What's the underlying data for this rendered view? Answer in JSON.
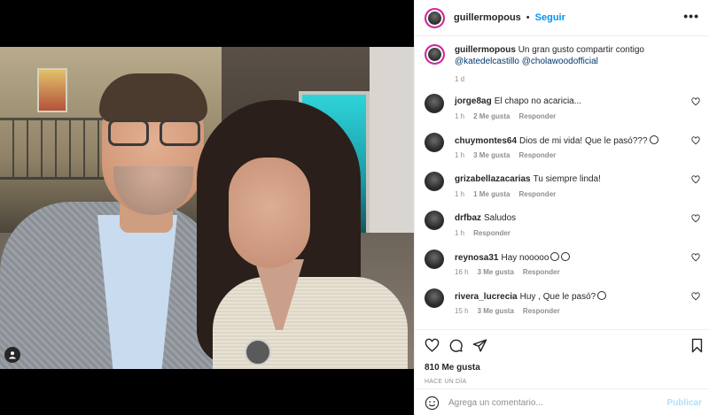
{
  "post": {
    "author": "guillermopous",
    "follow_label": "Seguir",
    "more_label": "•••",
    "separator": "•",
    "caption_text": "Un gran gusto compartir contigo",
    "caption_mentions": [
      "@katedelcastillo",
      "@cholawoodofficial"
    ],
    "caption_time": "1 d",
    "likes": "810 Me gusta",
    "time_ago": "HACE UN DÍA",
    "comment_placeholder": "Agrega un comentario...",
    "publish_label": "Publicar"
  },
  "comments": [
    {
      "user": "jorge8ag",
      "text": "El chapo no acaricia...",
      "time": "1 h",
      "likes": "2 Me gusta",
      "reply": "Responder",
      "emojis": 0
    },
    {
      "user": "chuymontes64",
      "text": "Dios de mi vida! Que le pasó???",
      "time": "1 h",
      "likes": "3 Me gusta",
      "reply": "Responder",
      "emojis": 1
    },
    {
      "user": "grizabellazacarias",
      "text": "Tu siempre linda!",
      "time": "1 h",
      "likes": "1 Me gusta",
      "reply": "Responder",
      "emojis": 0
    },
    {
      "user": "drfbaz",
      "text": "Saludos",
      "time": "1 h",
      "likes": "",
      "reply": "Responder",
      "emojis": 0
    },
    {
      "user": "reynosa31",
      "text": "Hay nooooo",
      "time": "16 h",
      "likes": "3 Me gusta",
      "reply": "Responder",
      "emojis": 2
    },
    {
      "user": "rivera_lucrecia",
      "text": "Huy , Que le pasó?",
      "time": "15 h",
      "likes": "3 Me gusta",
      "reply": "Responder",
      "emojis": 1
    }
  ],
  "icons": {
    "like": "heart-icon",
    "comment": "comment-icon",
    "share": "paper-plane-icon",
    "save": "bookmark-icon",
    "emoji": "smiley-icon",
    "tag": "person-tag-icon"
  },
  "colors": {
    "accent": "#0095f6",
    "publish_disabled": "#b2dffc",
    "muted": "#8e8e8e",
    "mention": "#00376b"
  }
}
